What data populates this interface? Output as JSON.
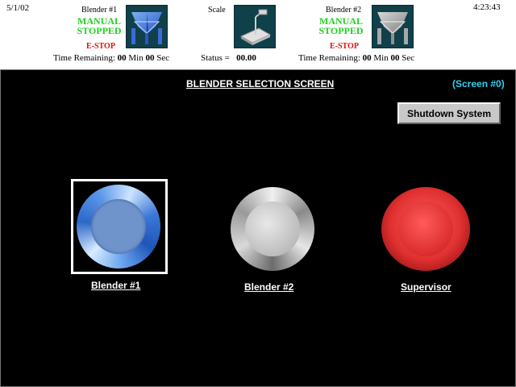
{
  "header": {
    "date": "5/1/02",
    "time": "4:23:43",
    "blender1": {
      "name": "Blender #1",
      "mode": "MANUAL",
      "state": "STOPPED",
      "estop": "E-STOP",
      "time_label": "Time Remaining:",
      "min_val": "00",
      "min_unit": "Min",
      "sec_val": "00",
      "sec_unit": "Sec"
    },
    "scale": {
      "name": "Scale",
      "status_label": "Status =",
      "status_val": "00.00"
    },
    "blender2": {
      "name": "Blender #2",
      "mode": "MANUAL",
      "state": "STOPPED",
      "estop": "E-STOP",
      "time_label": "Time Remaining:",
      "min_val": "00",
      "min_unit": "Min",
      "sec_val": "00",
      "sec_unit": "Sec"
    }
  },
  "main": {
    "title": "BLENDER SELECTION SCREEN",
    "screen_id": "(Screen #0)",
    "shutdown_label": "Shutdown System",
    "buttons": [
      {
        "label": "Blender #1",
        "color": "blue"
      },
      {
        "label": "Blender #2",
        "color": "silver"
      },
      {
        "label": "Supervisor",
        "color": "red"
      }
    ]
  },
  "colors": {
    "status_green": "#22d022",
    "estop_red": "#e01010",
    "screen_id_cyan": "#33d0f0",
    "background": "#000000"
  }
}
